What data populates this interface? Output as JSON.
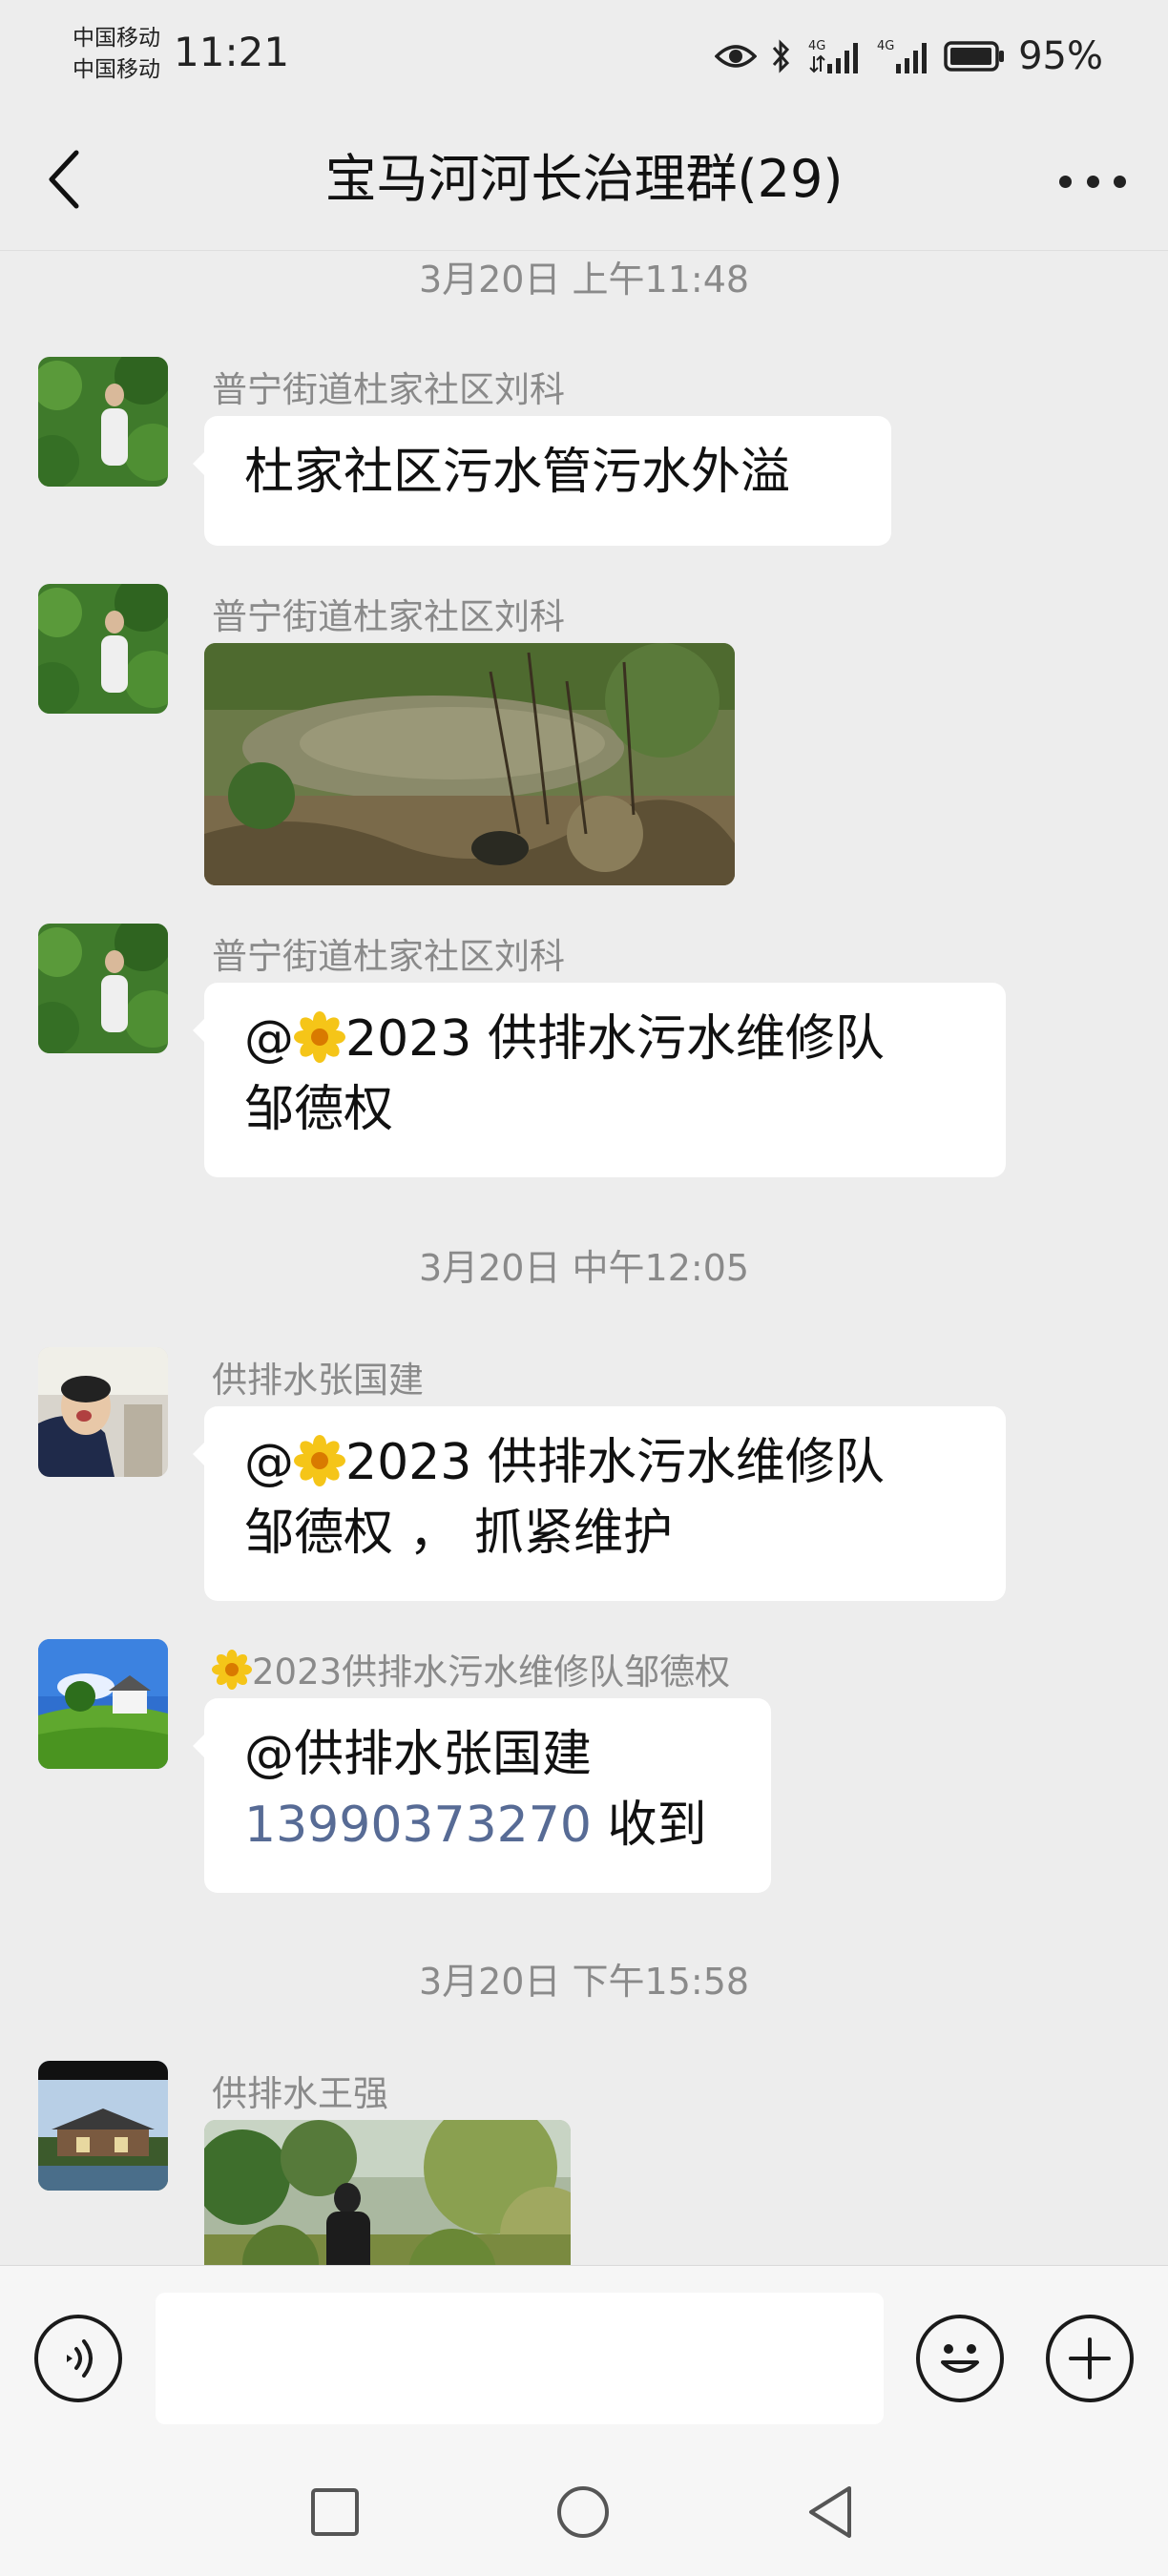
{
  "status_bar": {
    "carrier_1": "中国移动",
    "carrier_2": "中国移动",
    "time": "11:21",
    "network_label_1": "4G",
    "network_label_2": "4G",
    "battery": "95%"
  },
  "header": {
    "title": "宝马河河长治理群(29)",
    "back_icon": "chevron-left-icon",
    "more_icon": "more-dots-icon"
  },
  "messages": [
    {
      "type": "timestamp",
      "text": "3月20日 上午11:48"
    },
    {
      "type": "text",
      "sender": "普宁街道杜家社区刘科",
      "avatar": "woman-green-leaves",
      "text": "杜家社区污水管污水外溢"
    },
    {
      "type": "image",
      "sender": "普宁街道杜家社区刘科",
      "avatar": "woman-green-leaves",
      "image": "sewage-pond-photo"
    },
    {
      "type": "text",
      "sender": "普宁街道杜家社区刘科",
      "avatar": "woman-green-leaves",
      "prefix": "@",
      "emoji": "🌼",
      "line1": "2023 供排水污水维修队",
      "line2": "邹德权"
    },
    {
      "type": "timestamp",
      "text": "3月20日 中午12:05"
    },
    {
      "type": "text",
      "sender": "供排水张国建",
      "avatar": "child-photo",
      "prefix": "@",
      "emoji": "🌼",
      "line1": "2023 供排水污水维修队",
      "line2": "邹德权 ， 抓紧维护"
    },
    {
      "type": "text",
      "sender_emoji": "🌼",
      "sender": "2023供排水污水维修队邹德权",
      "avatar": "green-field-house",
      "line1": "@供排水张国建",
      "phone": "13990373270",
      "suffix": "收到"
    },
    {
      "type": "timestamp",
      "text": "3月20日 下午15:58"
    },
    {
      "type": "image",
      "sender": "供排水王强",
      "avatar": "house-photo",
      "image": "garden-man-photo"
    }
  ],
  "input_bar": {
    "voice_icon": "voice-icon",
    "placeholder": "",
    "emoji_icon": "smiley-icon",
    "plus_icon": "plus-icon"
  },
  "nav_bar": {
    "recent_icon": "square-icon",
    "home_icon": "circle-icon",
    "back_icon": "triangle-back-icon"
  }
}
